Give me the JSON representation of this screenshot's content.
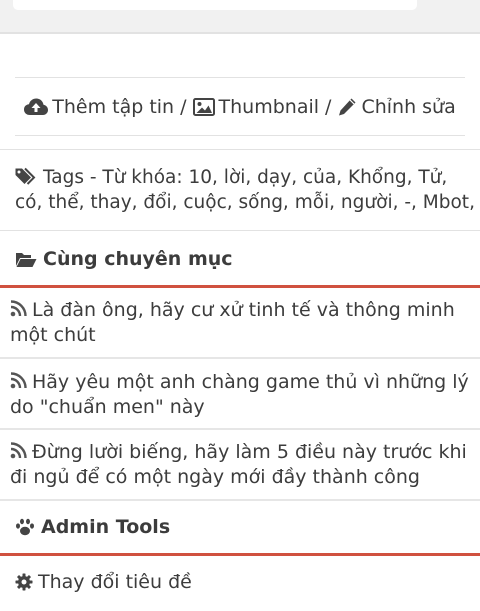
{
  "actions": {
    "upload_label": "Thêm tập tin",
    "thumbnail_label": "Thumbnail",
    "edit_label": "Chỉnh sửa",
    "separator": "/"
  },
  "tags": {
    "label": "Tags - Từ khóa: 10, lời, dạy, của, Khổng, Tử, có, thể, thay, đổi, cuộc, sống, mỗi, người, -, Mbot,"
  },
  "related": {
    "title": "Cùng chuyên mục",
    "posts": [
      {
        "title": "Là đàn ông, hãy cư xử tinh tế và thông minh một chút"
      },
      {
        "title": "Hãy yêu một anh chàng game thủ vì những lý do \"chuẩn men\" này"
      },
      {
        "title": "Đừng lười biếng, hãy làm 5 điều này trước khi đi ngủ để có một ngày mới đầy thành công"
      }
    ]
  },
  "admin": {
    "title": "Admin Tools",
    "items": [
      {
        "label": "Thay đổi tiêu đề"
      }
    ]
  },
  "colors": {
    "accent_red": "#d0513f",
    "text": "#3c3c3c",
    "divider": "#e2e2e2"
  },
  "icons": {
    "upload": "cloud-upload-icon",
    "thumbnail": "image-icon",
    "edit": "pencil-icon",
    "tags": "tags-icon",
    "related": "folder-open-icon",
    "post": "rss-icon",
    "admin": "paw-icon",
    "tool": "gear-icon"
  }
}
